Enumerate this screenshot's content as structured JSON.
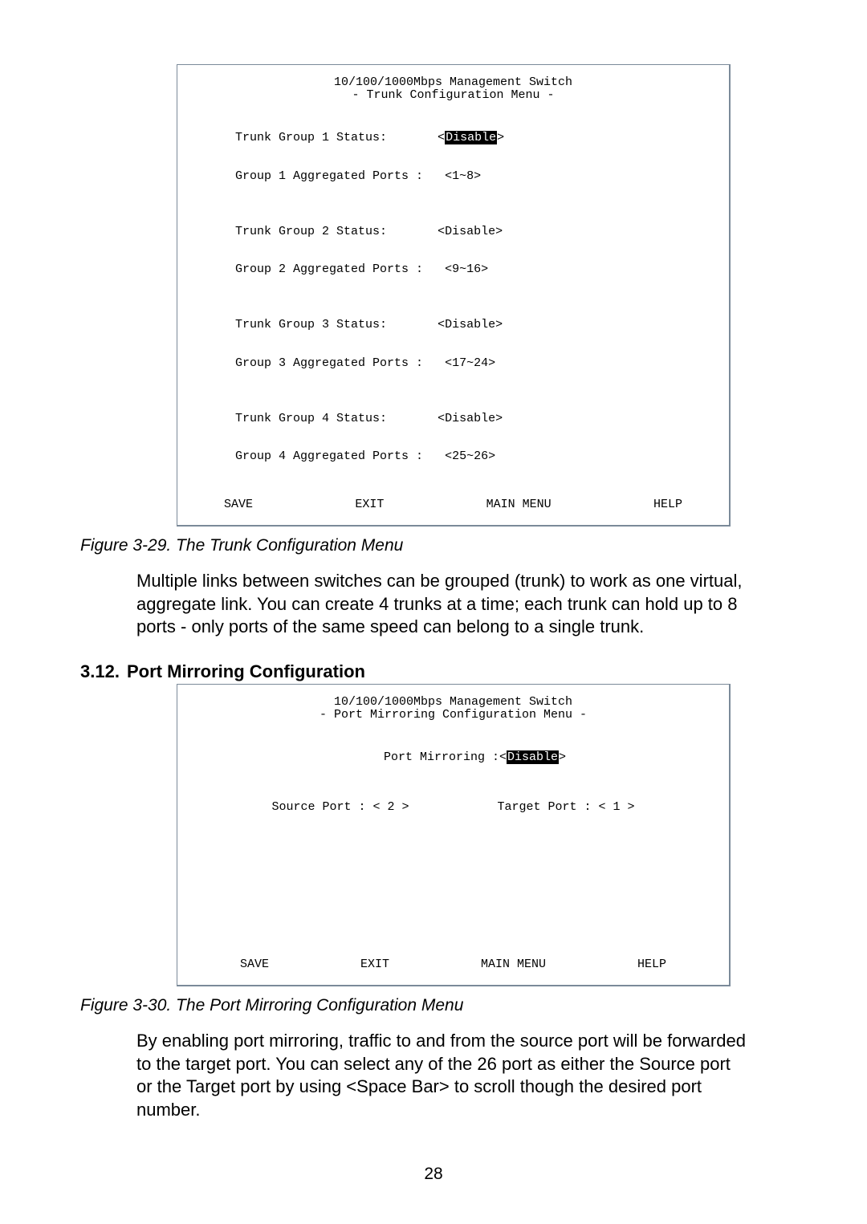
{
  "term1": {
    "title1": "10/100/1000Mbps Management Switch",
    "title2": "- Trunk Configuration Menu -",
    "groups": [
      {
        "status_label": "Trunk Group 1 Status:",
        "status_value": "Disable",
        "status_hl": true,
        "ports_label": "Group 1 Aggregated Ports :",
        "ports_value": "<1~8>"
      },
      {
        "status_label": "Trunk Group 2 Status:",
        "status_value": "<Disable>",
        "status_hl": false,
        "ports_label": "Group 2 Aggregated Ports :",
        "ports_value": "<9~16>"
      },
      {
        "status_label": "Trunk Group 3 Status:",
        "status_value": "<Disable>",
        "status_hl": false,
        "ports_label": "Group 3 Aggregated Ports :",
        "ports_value": "<17~24>"
      },
      {
        "status_label": "Trunk Group 4 Status:",
        "status_value": "<Disable>",
        "status_hl": false,
        "ports_label": "Group 4 Aggregated Ports :",
        "ports_value": "<25~26>"
      }
    ],
    "footer": {
      "save": "SAVE",
      "exit": "EXIT",
      "main": "MAIN MENU",
      "help": "HELP"
    }
  },
  "caption1": "Figure 3-29. The Trunk Configuration Menu",
  "para1": "Multiple links between switches can be grouped (trunk) to work as one virtual, aggregate link. You can create 4 trunks at a time; each trunk can hold up to 8 ports - only ports of the same speed can belong to a single trunk.",
  "section": {
    "num": "3.12.",
    "title": "Port Mirroring Configuration"
  },
  "term2": {
    "title1": "10/100/1000Mbps Management Switch",
    "title2": "- Port Mirroring Configuration Menu -",
    "mirror_label": "Port Mirroring :<",
    "mirror_value": "Disable",
    "mirror_tail": ">",
    "source_label": "Source Port : < 2 >",
    "target_label": "Target Port : < 1 >",
    "footer": {
      "save": "SAVE",
      "exit": "EXIT",
      "main": "MAIN MENU",
      "help": "HELP"
    }
  },
  "caption2": "Figure 3-30. The Port Mirroring Configuration Menu",
  "para2": "By enabling port mirroring, traffic to and from the source port will be forwarded to the target port. You can select any of the 26 port as either the Source port or the Target port by using <Space Bar> to scroll though the desired port number.",
  "pagenum": "28"
}
